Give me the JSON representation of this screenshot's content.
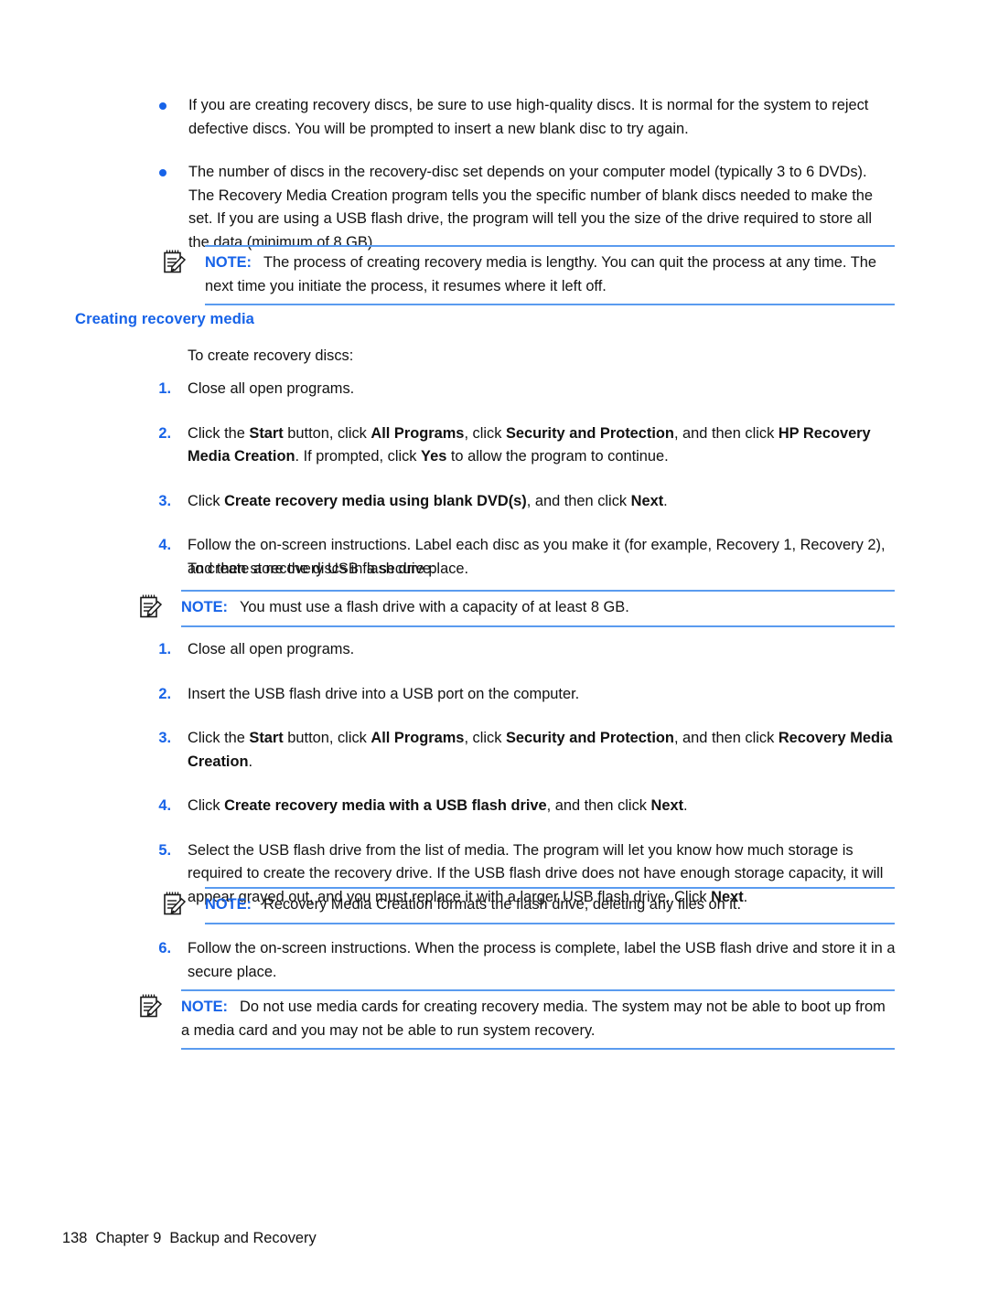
{
  "document": {
    "bullets": [
      "If you are creating recovery discs, be sure to use high-quality discs. It is normal for the system to reject defective discs. You will be prompted to insert a new blank disc to try again.",
      "The number of discs in the recovery-disc set depends on your computer model (typically 3 to 6 DVDs). The Recovery Media Creation program tells you the specific number of blank discs needed to make the set. If you are using a USB flash drive, the program will tell you the size of the drive required to store all the data (minimum of 8 GB)."
    ],
    "note_label": "NOTE:",
    "notes": {
      "note1": "The process of creating recovery media is lengthy. You can quit the process at any time. The next time you initiate the process, it resumes where it left off.",
      "note2": "You must use a flash drive with a capacity of at least 8 GB.",
      "note3": "Recovery Media Creation formats the flash drive, deleting any files on it.",
      "note4": "Do not use media cards for creating recovery media. The system may not be able to boot up from a media card and you may not be able to run system recovery."
    },
    "heading": "Creating recovery media",
    "lead_discs": "To create recovery discs:",
    "lead_usb": "To create a recovery USB flash drive:",
    "disc_steps": {
      "n1": "1.",
      "s1": "Close all open programs.",
      "n2": "2.",
      "s2_a": "Click the ",
      "s2_b1": "Start",
      "s2_c": " button, click ",
      "s2_b2": "All Programs",
      "s2_d": ", click ",
      "s2_b3": "Security and Protection",
      "s2_e": ", and then click ",
      "s2_b4": "HP Recovery Media Creation",
      "s2_f": ". If prompted, click ",
      "s2_b5": "Yes",
      "s2_g": " to allow the program to continue.",
      "n3": "3.",
      "s3_a": "Click ",
      "s3_b1": "Create recovery media using blank DVD(s)",
      "s3_c": ", and then click ",
      "s3_b2": "Next",
      "s3_d": ".",
      "n4": "4.",
      "s4": "Follow the on-screen instructions. Label each disc as you make it (for example, Recovery 1, Recovery 2), and then store the discs in a secure place."
    },
    "usb_steps": {
      "n1": "1.",
      "s1": "Close all open programs.",
      "n2": "2.",
      "s2": "Insert the USB flash drive into a USB port on the computer.",
      "n3": "3.",
      "s3_a": "Click the ",
      "s3_b1": "Start",
      "s3_c": " button, click ",
      "s3_b2": "All Programs",
      "s3_d": ", click ",
      "s3_b3": "Security and Protection",
      "s3_e": ", and then click ",
      "s3_b4": "Recovery Media Creation",
      "s3_f": ".",
      "n4": "4.",
      "s4_a": "Click ",
      "s4_b1": "Create recovery media with a USB flash drive",
      "s4_c": ", and then click ",
      "s4_b2": "Next",
      "s4_d": ".",
      "n5": "5.",
      "s5_a": "Select the USB flash drive from the list of media. The program will let you know how much storage is required to create the recovery drive. If the USB flash drive does not have enough storage capacity, it will appear grayed out, and you must replace it with a larger USB flash drive. Click ",
      "s5_b1": "Next",
      "s5_c": ".",
      "n6": "6.",
      "s6": "Follow the on-screen instructions. When the process is complete, label the USB flash drive and store it in a secure place."
    },
    "footer": {
      "page_number": "138",
      "chapter": "Chapter 9",
      "title": "Backup and Recovery"
    },
    "colors": {
      "accent_blue": "#1763e8",
      "rule_blue": "#5a9bef",
      "text": "#111111"
    }
  }
}
